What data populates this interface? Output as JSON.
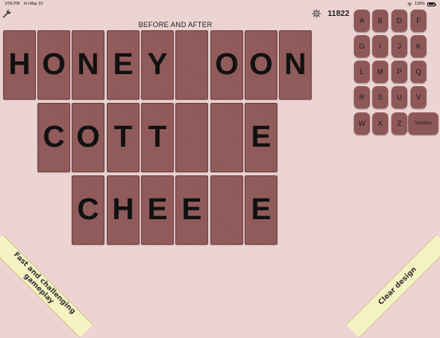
{
  "status_bar": {
    "time": "3:56 PM",
    "date": "Fri May 10",
    "battery": "100%"
  },
  "header": {
    "title": "BEFORE AND AFTER",
    "score": "11822"
  },
  "board": {
    "rows": [
      [
        "H",
        "O",
        "N",
        "E",
        "Y",
        "",
        "O",
        "O",
        "N"
      ],
      [
        "C",
        "O",
        "T",
        "T",
        "",
        "",
        "E"
      ],
      [
        "C",
        "H",
        "E",
        "E",
        "",
        "E"
      ]
    ]
  },
  "keyboard": {
    "keys": [
      "A",
      "B",
      "D",
      "F",
      "G",
      "I",
      "J",
      "K",
      "L",
      "M",
      "P",
      "Q",
      "R",
      "S",
      "U",
      "V",
      "W",
      "X",
      "Z"
    ],
    "solution_label": "Solution"
  },
  "banners": {
    "left": "Fast and challenging\ngameplay",
    "right": "Clear design"
  }
}
